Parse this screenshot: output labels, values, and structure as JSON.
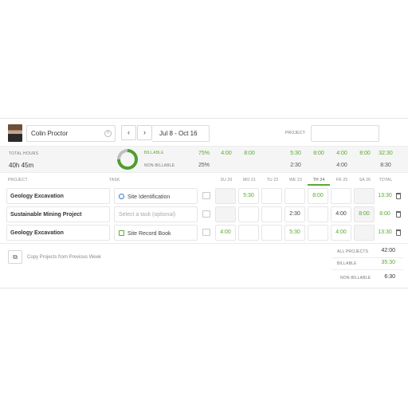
{
  "header": {
    "user_name": "Colin Proctor",
    "prev_label": "‹",
    "next_label": "›",
    "date_range": "Jul 8 - Oct 16",
    "project_label": "PROJECT:"
  },
  "summary": {
    "total_hours_label": "TOTAL HOURS",
    "total_hours_value": "40h 45m",
    "billable_label": "BILLABLE",
    "non_billable_label": "NON-BILLABLE",
    "billable_pct": "75%",
    "non_billable_pct": "25%",
    "billable_fraction": 0.75,
    "billable_days": [
      "4:00",
      "8:00",
      "",
      "5:30",
      "8:00",
      "4:00",
      "8:00"
    ],
    "non_billable_days": [
      "",
      "",
      "",
      "2:30",
      "",
      "4:00",
      ""
    ],
    "billable_total": "32:30",
    "non_billable_total": "8:30"
  },
  "columns": {
    "project": "PROJECT",
    "task": "TASK",
    "days": [
      "SU 20",
      "MO 21",
      "TU 22",
      "WE 23",
      "TH 24",
      "FR 25",
      "SA 26"
    ],
    "total": "TOTAL"
  },
  "rows": [
    {
      "project": "Geology Excavation",
      "task": "Site Identification",
      "task_placeholder": false,
      "cells": [
        "",
        "5:30",
        "",
        "",
        "8:00",
        "",
        ""
      ],
      "total": "13:30"
    },
    {
      "project": "Sustainable Mining Project",
      "task": "Select a task (optional)",
      "task_placeholder": true,
      "cells": [
        "",
        "",
        "",
        "2:30",
        "",
        "4:00",
        "8:00"
      ],
      "total": "8:00"
    },
    {
      "project": "Geology Excavation",
      "task": "Site Record Book",
      "task_placeholder": false,
      "cells": [
        "4:00",
        "",
        "",
        "5:30",
        "",
        "4:00",
        ""
      ],
      "total": "13:30"
    }
  ],
  "footer": {
    "copy_label": "Copy Projects from Previous Week",
    "all_projects_label": "ALL PROJECTS",
    "all_projects_value": "42:00",
    "billable_label": "BILLABLE",
    "billable_value": "35:30",
    "non_billable_label": "NON-BILLABLE",
    "non_billable_value": "6:30"
  },
  "colors": {
    "accent_green": "#5aaa33",
    "donut_gray": "#bfbfbf"
  }
}
